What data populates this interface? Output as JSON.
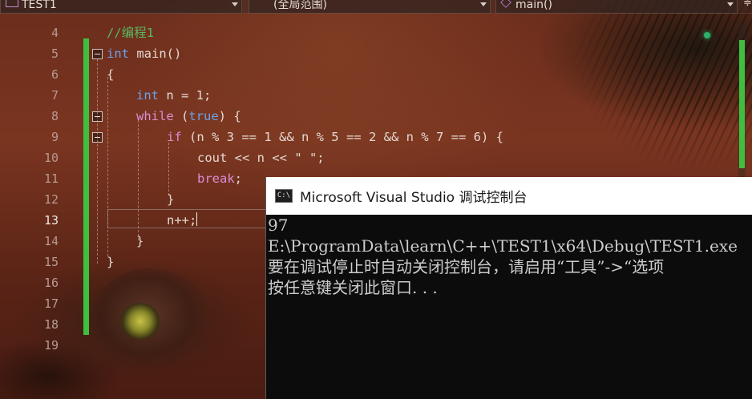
{
  "navbar": {
    "project": "TEST1",
    "scope": "(全局范围)",
    "member": "main()"
  },
  "editor": {
    "line_numbers": [
      "4",
      "5",
      "6",
      "7",
      "8",
      "9",
      "10",
      "11",
      "12",
      "13",
      "14",
      "15",
      "16",
      "17",
      "18",
      "19"
    ],
    "current_line": "13",
    "code": {
      "l4_comment": "//编程1",
      "l5_kw": "int",
      "l5_rest": " main()",
      "l6": "{",
      "l7_kw": "int",
      "l7_rest": " n = 1;",
      "l8_kw": "while",
      "l8_mid": " (",
      "l8_kw2": "true",
      "l8_rest": ") {",
      "l9_kw": "if",
      "l9_rest": " (n % 3 == 1 && n % 5 == 2 && n % 7 == 6) {",
      "l10": "cout << n << \" \";",
      "l11_kw": "break",
      "l11_rest": ";",
      "l12": "}",
      "l13": "n++;",
      "l14": "}",
      "l15": "}"
    }
  },
  "console": {
    "title": "Microsoft Visual Studio 调试控制台",
    "icon_text": "C:\\",
    "lines": [
      "97",
      "E:\\ProgramData\\learn\\C++\\TEST1\\x64\\Debug\\TEST1.exe",
      "要在调试停止时自动关闭控制台，请启用“工具”->“选项",
      "按任意键关闭此窗口. . ."
    ]
  },
  "colors": {
    "keyword": "#6aa2e8",
    "control_keyword": "#d98fd6",
    "comment": "#59b960",
    "change_bar": "#3fbf3f"
  },
  "icons": [
    "project-icon",
    "chevron-down-icon",
    "cube-icon",
    "split-icon",
    "collapse-icon",
    "console-app-icon"
  ]
}
